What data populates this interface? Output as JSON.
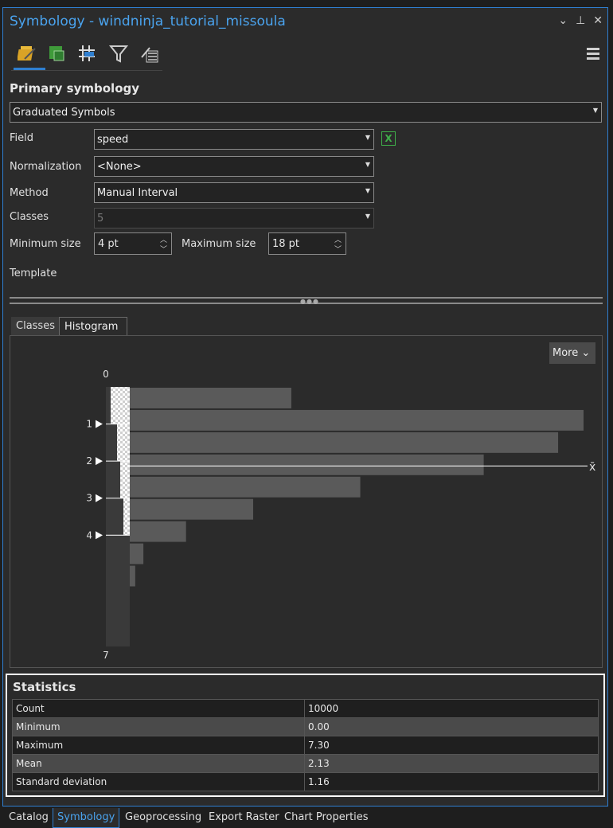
{
  "window": {
    "title": "Symbology - windninja_tutorial_missoula"
  },
  "toolbar": {
    "icons": [
      "primary-symbology-icon",
      "vary-symbology-icon",
      "symbol-layer-drawing-icon",
      "filter-icon",
      "display-options-icon"
    ],
    "active_index": 0
  },
  "primary": {
    "title": "Primary symbology",
    "renderer": "Graduated Symbols",
    "field_label": "Field",
    "field_value": "speed",
    "normalization_label": "Normalization",
    "normalization_value": "<None>",
    "method_label": "Method",
    "method_value": "Manual Interval",
    "classes_label": "Classes",
    "classes_value": "5",
    "min_size_label": "Minimum size",
    "min_size_value": "4 pt",
    "max_size_label": "Maximum size",
    "max_size_value": "18 pt",
    "template_label": "Template"
  },
  "tabs": {
    "classes": "Classes",
    "histogram": "Histogram",
    "active": "Histogram"
  },
  "histogram": {
    "more_label": "More",
    "top_label": "0",
    "bottom_label": "7",
    "mean_symbol": "x̄",
    "breaks": [
      "1",
      "2",
      "3",
      "4"
    ],
    "break_values": [
      1,
      2,
      3,
      4
    ],
    "bar_color": "#5a5a5a"
  },
  "chart_data": {
    "type": "bar",
    "orientation": "horizontal",
    "title": "",
    "ylim": [
      0,
      7
    ],
    "bins": [
      {
        "from": 0.0,
        "to": 0.6,
        "count": 890
      },
      {
        "from": 0.6,
        "to": 1.2,
        "count": 2500
      },
      {
        "from": 1.2,
        "to": 1.8,
        "count": 2360
      },
      {
        "from": 1.8,
        "to": 2.4,
        "count": 1950
      },
      {
        "from": 2.4,
        "to": 3.0,
        "count": 1270
      },
      {
        "from": 3.0,
        "to": 3.6,
        "count": 680
      },
      {
        "from": 3.6,
        "to": 4.2,
        "count": 310
      },
      {
        "from": 4.2,
        "to": 4.8,
        "count": 75
      },
      {
        "from": 4.8,
        "to": 5.4,
        "count": 30
      },
      {
        "from": 5.4,
        "to": 6.0,
        "count": 0
      },
      {
        "from": 6.0,
        "to": 6.6,
        "count": 0
      },
      {
        "from": 6.6,
        "to": 7.2,
        "count": 0
      }
    ],
    "mean": 2.13
  },
  "statistics": {
    "title": "Statistics",
    "rows": [
      {
        "key": "Count",
        "value": "10000"
      },
      {
        "key": "Minimum",
        "value": "0.00"
      },
      {
        "key": "Maximum",
        "value": "7.30"
      },
      {
        "key": "Mean",
        "value": "2.13"
      },
      {
        "key": "Standard deviation",
        "value": "1.16"
      }
    ]
  },
  "bottom_tabs": [
    "Catalog",
    "Symbology",
    "Geoprocessing",
    "Export Raster",
    "Chart Properties"
  ],
  "colors": {
    "accent": "#2f7fd0",
    "title": "#4aa3ee",
    "excel": "#3fae49"
  }
}
